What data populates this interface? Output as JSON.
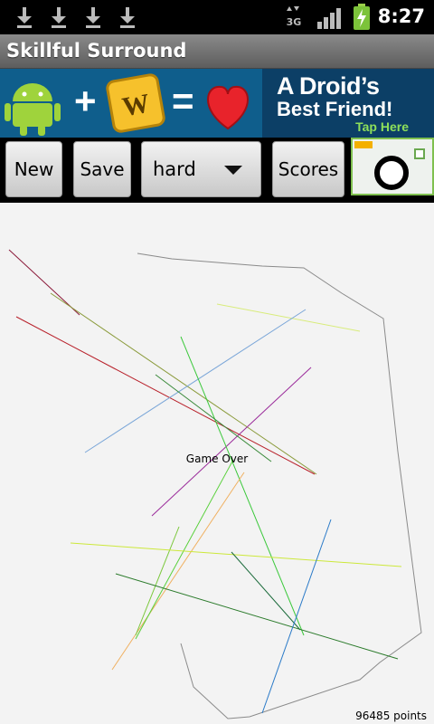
{
  "statusbar": {
    "time": "8:27",
    "network": "3G",
    "icons": [
      "download-icon",
      "download-icon",
      "download-icon",
      "download-icon",
      "data-3g-icon",
      "signal-icon",
      "battery-charging-icon"
    ]
  },
  "app": {
    "title": "Skillful Surround"
  },
  "ad": {
    "headline": "A Droid’s",
    "subline": "Best Friend!",
    "cta": "Tap Here",
    "plus": "+",
    "equals": "=",
    "colors": {
      "left_bg": "#0f5e8c",
      "right_bg": "#0c3f66",
      "cta": "#8ee05a"
    }
  },
  "toolbar": {
    "new_label": "New",
    "save_label": "Save",
    "difficulty_selected": "hard",
    "scores_label": "Scores",
    "camera_icon": "camera-icon"
  },
  "game": {
    "status": "Game Over",
    "points": "96485 points",
    "background": "#f3f3f3"
  }
}
